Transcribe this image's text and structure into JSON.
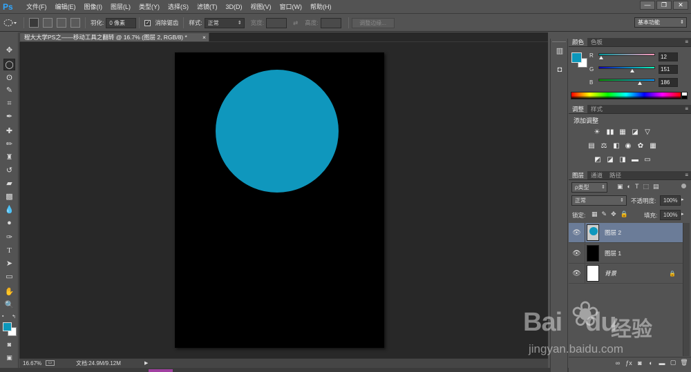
{
  "app": {
    "logo": "Ps"
  },
  "menu": [
    "文件(F)",
    "编辑(E)",
    "图像(I)",
    "图层(L)",
    "类型(Y)",
    "选择(S)",
    "滤镜(T)",
    "3D(D)",
    "视图(V)",
    "窗口(W)",
    "帮助(H)"
  ],
  "window_buttons": [
    "—",
    "❐",
    "✕"
  ],
  "options": {
    "feather_label": "羽化:",
    "feather_value": "0 像素",
    "antialias_label": "消除锯齿",
    "style_label": "样式:",
    "style_value": "正常",
    "width_label": "宽度:",
    "height_label": "高度:",
    "refine_edge": "调整边缘...",
    "workspace": "基本功能"
  },
  "document": {
    "tab_title": "程大大学PS之——移动工具之翻转 @ 16.7% (图层 2, RGB/8) *",
    "zoom": "16.67%",
    "doc_size": "文档:24.9M/9.12M",
    "circle_color": "#0f97bd"
  },
  "color_panel": {
    "tabs": [
      "颜色",
      "色板"
    ],
    "r_label": "R",
    "g_label": "G",
    "b_label": "B",
    "r": "12",
    "g": "151",
    "b": "186",
    "r_fraction": 0.047,
    "g_fraction": 0.592,
    "b_fraction": 0.729,
    "foreground": "#0c97ba"
  },
  "adjust_panel": {
    "tabs": [
      "调整",
      "样式"
    ],
    "title": "添加调整",
    "row1": [
      "☀",
      "▮▮",
      "▦",
      "◪",
      "▽"
    ],
    "row2": [
      "▤",
      "⚖",
      "◧",
      "◉",
      "✿",
      "▦"
    ],
    "row3": [
      "◩",
      "◪",
      "◨",
      "▬",
      "▭"
    ]
  },
  "layers_panel": {
    "tabs": [
      "图层",
      "通道",
      "路径"
    ],
    "filter_label": "ρ类型",
    "blend_mode": "正常",
    "opacity_label": "不透明度:",
    "opacity_value": "100%",
    "lock_label": "锁定:",
    "fill_label": "填充:",
    "fill_value": "100%",
    "layers": [
      {
        "name": "图层 2",
        "selected": true
      },
      {
        "name": "图层 1",
        "selected": false
      },
      {
        "name": "背景",
        "selected": false
      }
    ]
  },
  "watermark": {
    "brand_a": "Bai",
    "brand_b": "du",
    "brand_cn": "经验",
    "url": "jingyan.baidu.com"
  }
}
